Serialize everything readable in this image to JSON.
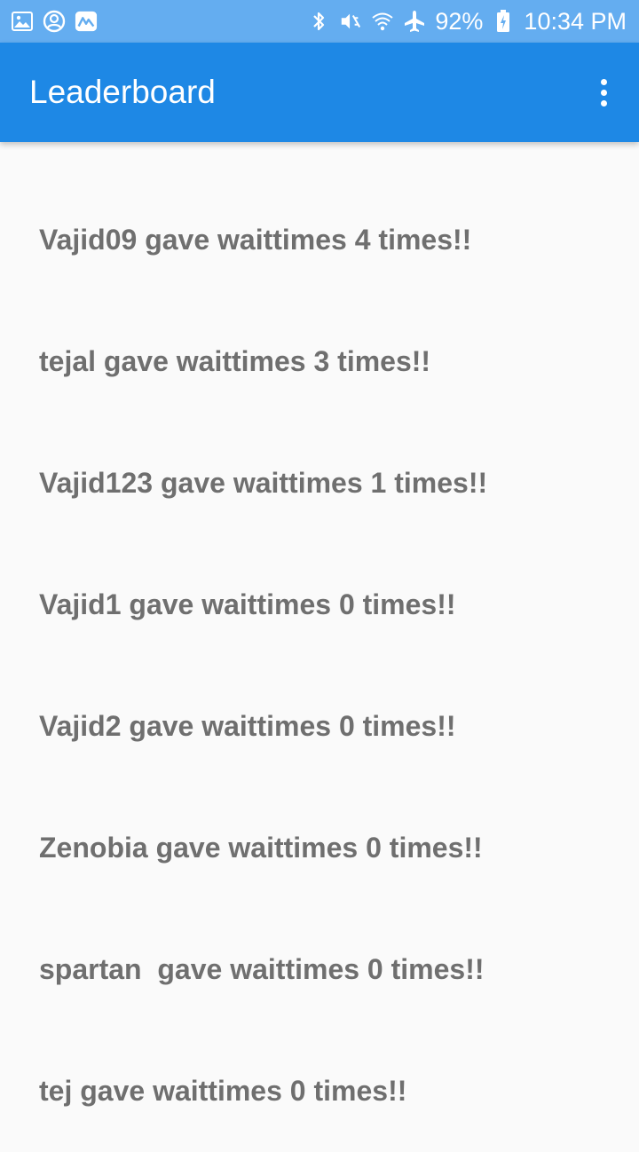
{
  "status_bar": {
    "left_icons": [
      "gallery-icon",
      "account-circle-icon",
      "app-notification-icon"
    ],
    "right_icons": [
      "bluetooth-icon",
      "mute-vibrate-icon",
      "wifi-icon",
      "airplane-mode-icon"
    ],
    "battery": "92%",
    "time": "10:34 PM"
  },
  "app_bar": {
    "title": "Leaderboard",
    "menu_icon": "more-vert-icon",
    "background": "#1e88e5"
  },
  "leaderboard": {
    "items": [
      {
        "text": "Vajid09 gave waittimes 4 times!!"
      },
      {
        "text": "tejal gave waittimes 3 times!!"
      },
      {
        "text": "Vajid123 gave waittimes 1 times!!"
      },
      {
        "text": "Vajid1 gave waittimes 0 times!!"
      },
      {
        "text": "Vajid2 gave waittimes 0 times!!"
      },
      {
        "text": "Zenobia gave waittimes 0 times!!"
      },
      {
        "text": "spartan  gave waittimes 0 times!!"
      },
      {
        "text": "tej gave waittimes 0 times!!"
      }
    ]
  }
}
